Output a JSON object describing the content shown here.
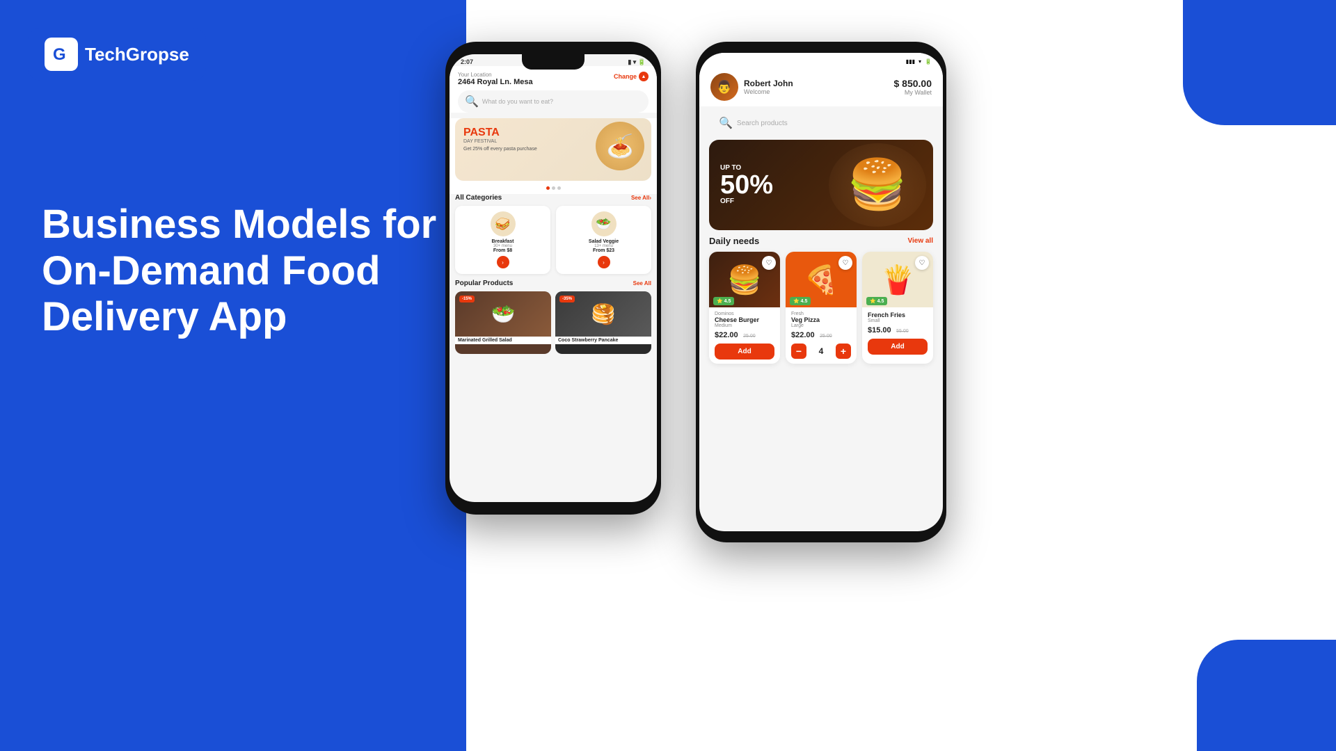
{
  "brand": {
    "name": "TechGropse",
    "logo_letter": "G"
  },
  "hero": {
    "line1": "Business Models for",
    "line2": "On-Demand Food",
    "line3": "Delivery App"
  },
  "phone1": {
    "status_time": "2:07",
    "location": {
      "label": "Your Location",
      "address": "2464 Royal Ln. Mesa",
      "change_text": "Change"
    },
    "search_placeholder": "What do you want to eat?",
    "banner": {
      "title": "PASTA",
      "subtitle": "DAY FESTIVAL",
      "description": "Get 25% off every pasta purchase",
      "food_emoji": "🍝"
    },
    "categories_title": "All Categories",
    "see_all": "See All",
    "categories": [
      {
        "name": "Breakfast",
        "menu_count": "30+ menu",
        "from_price": "From $8",
        "emoji": "🥪"
      },
      {
        "name": "Salad Veggie",
        "menu_count": "13+ menu",
        "from_price": "From $23",
        "emoji": "🥗"
      }
    ],
    "popular_title": "Popular Products",
    "popular_see_all": "See All",
    "popular_products": [
      {
        "name": "Marinated Grilled Salad",
        "discount": "-15%",
        "emoji": "🥗"
      },
      {
        "name": "Coco Strawberry Pancake",
        "discount": "-35%",
        "emoji": "🥞"
      }
    ]
  },
  "phone2": {
    "status_icons": "▮▮▮ ▾ ▮▮",
    "user": {
      "name": "Robert John",
      "welcome": "Welcome",
      "avatar_emoji": "👨"
    },
    "wallet": {
      "amount": "$ 850.00",
      "label": "My Wallet"
    },
    "search_placeholder": "Search products",
    "hero_banner": {
      "badge_line1": "UP TO",
      "badge_line2": "50%",
      "badge_line3": "OFF",
      "emoji": "🍔"
    },
    "daily_needs": {
      "title": "Daily needs",
      "view_all": "View all"
    },
    "products": [
      {
        "store": "Dominos",
        "name": "Cheese Burger",
        "size": "Medium",
        "price": "$22.00",
        "old_price": "25.00",
        "rating": "4.5",
        "action": "add",
        "emoji": "🍔",
        "bg": "burger"
      },
      {
        "store": "Fresh",
        "name": "Veg Pizza",
        "size": "Large",
        "price": "$22.00",
        "old_price": "25.00",
        "rating": "4.5",
        "action": "qty",
        "qty": "4",
        "emoji": "🍕",
        "bg": "pizza"
      },
      {
        "store": "",
        "name": "French Fries",
        "size": "Small",
        "price": "$15.00",
        "old_price": "55.00",
        "rating": "4.5",
        "action": "add",
        "emoji": "🍟",
        "bg": "fries"
      }
    ]
  }
}
